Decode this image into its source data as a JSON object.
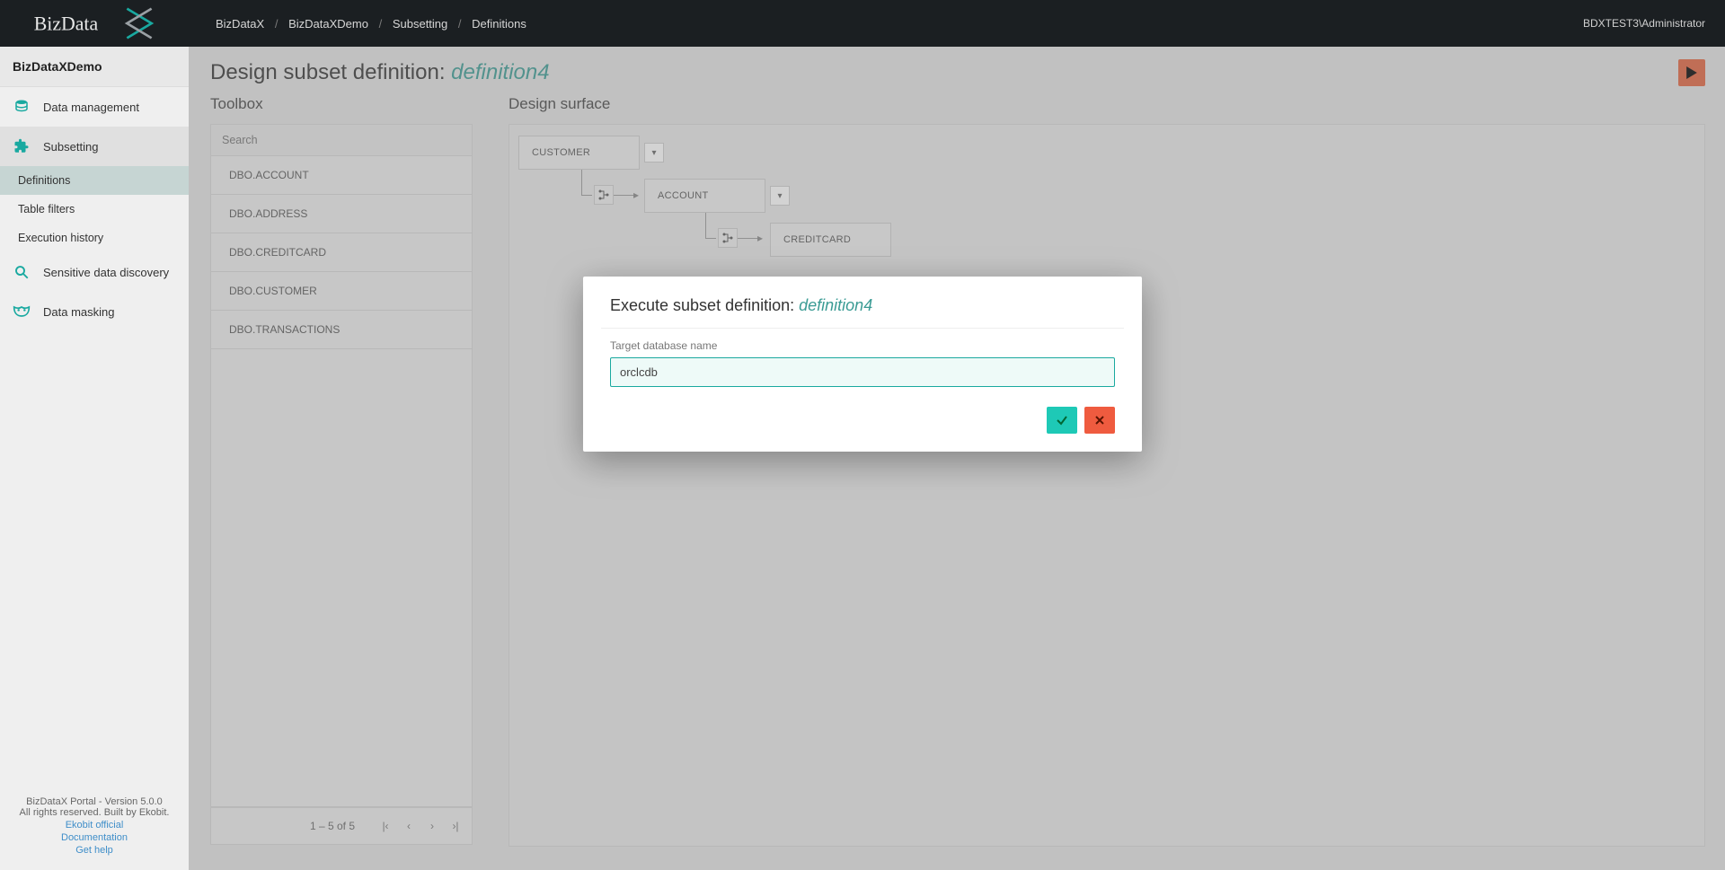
{
  "header": {
    "breadcrumbs": [
      "BizDataX",
      "BizDataXDemo",
      "Subsetting",
      "Definitions"
    ],
    "user": "BDXTEST3\\Administrator",
    "logo_text": "BizData"
  },
  "sidebar": {
    "project": "BizDataXDemo",
    "items": [
      {
        "label": "Data management",
        "icon": "database-icon"
      },
      {
        "label": "Subsetting",
        "icon": "puzzle-icon",
        "active": true,
        "subs": [
          {
            "label": "Definitions",
            "active": true
          },
          {
            "label": "Table filters"
          },
          {
            "label": "Execution history"
          }
        ]
      },
      {
        "label": "Sensitive data discovery",
        "icon": "search-icon"
      },
      {
        "label": "Data masking",
        "icon": "mask-icon"
      }
    ],
    "footer": {
      "line1": "BizDataX Portal - Version 5.0.0",
      "line2": "All rights reserved. Built by Ekobit.",
      "links": [
        "Ekobit official",
        "Documentation",
        "Get help"
      ]
    }
  },
  "page": {
    "title_prefix": "Design subset definition: ",
    "title_name": "definition4"
  },
  "toolbox": {
    "title": "Toolbox",
    "search_placeholder": "Search",
    "items": [
      "DBO.ACCOUNT",
      "DBO.ADDRESS",
      "DBO.CREDITCARD",
      "DBO.CUSTOMER",
      "DBO.TRANSACTIONS"
    ],
    "pager": "1 – 5 of 5"
  },
  "surface": {
    "title": "Design surface",
    "nodes": {
      "n1": "CUSTOMER",
      "n2": "ACCOUNT",
      "n3": "CREDITCARD"
    }
  },
  "modal": {
    "title_prefix": "Execute subset definition: ",
    "title_name": "definition4",
    "field_label": "Target database name",
    "field_value": "orclcdb"
  }
}
